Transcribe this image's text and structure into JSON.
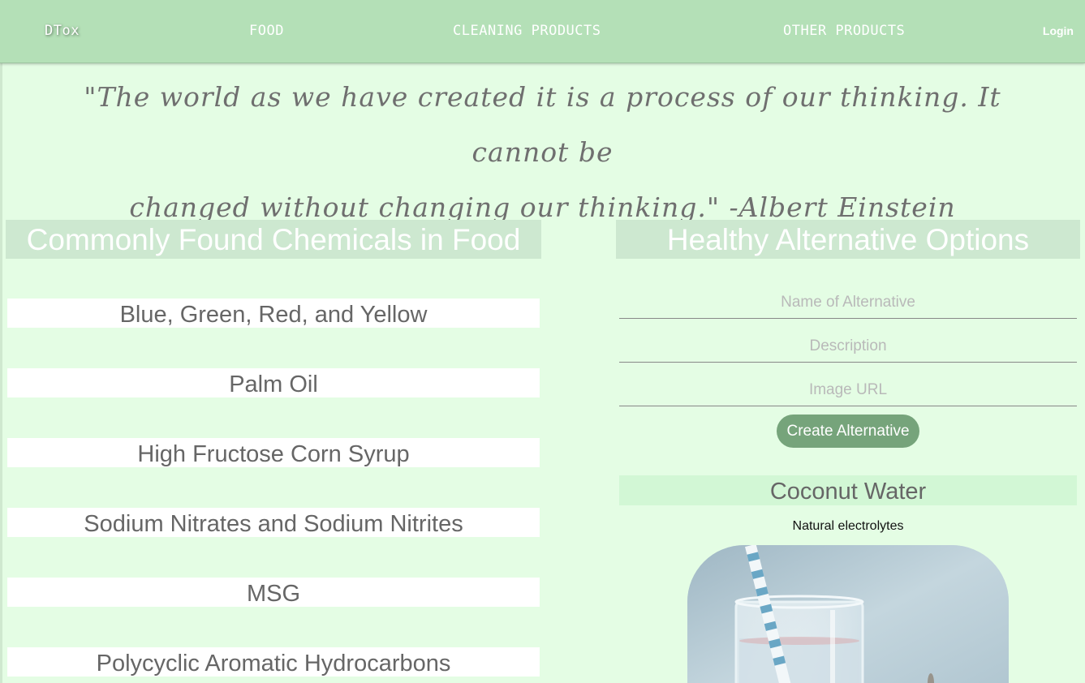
{
  "nav": {
    "brand": "DTox",
    "food": "FOOD",
    "cleaning": "CLEANING PRODUCTS",
    "other": "OTHER PRODUCTS",
    "login": "Login"
  },
  "quote": {
    "line1": "\"The world as we have created it is a process of our thinking. It cannot be",
    "line2": "changed without changing our thinking.\" -Albert Einstein"
  },
  "chemicals": {
    "title": "Commonly Found Chemicals in Food",
    "items": [
      "Blue, Green, Red, and Yellow",
      "Palm Oil",
      "High Fructose Corn Syrup",
      "Sodium Nitrates and Sodium Nitrites",
      "MSG",
      "Polycyclic Aromatic Hydrocarbons"
    ]
  },
  "alternatives": {
    "title": "Healthy Alternative Options",
    "form": {
      "name_placeholder": "Name of Alternative",
      "description_placeholder": "Description",
      "image_placeholder": "Image URL",
      "submit_label": "Create Alternative"
    },
    "cards": [
      {
        "name": "Coconut Water",
        "description": "Natural electrolytes"
      }
    ]
  },
  "colors": {
    "navbar": "#b4e0b7",
    "page_background": "#e4fde4",
    "button": "#76a47b"
  }
}
